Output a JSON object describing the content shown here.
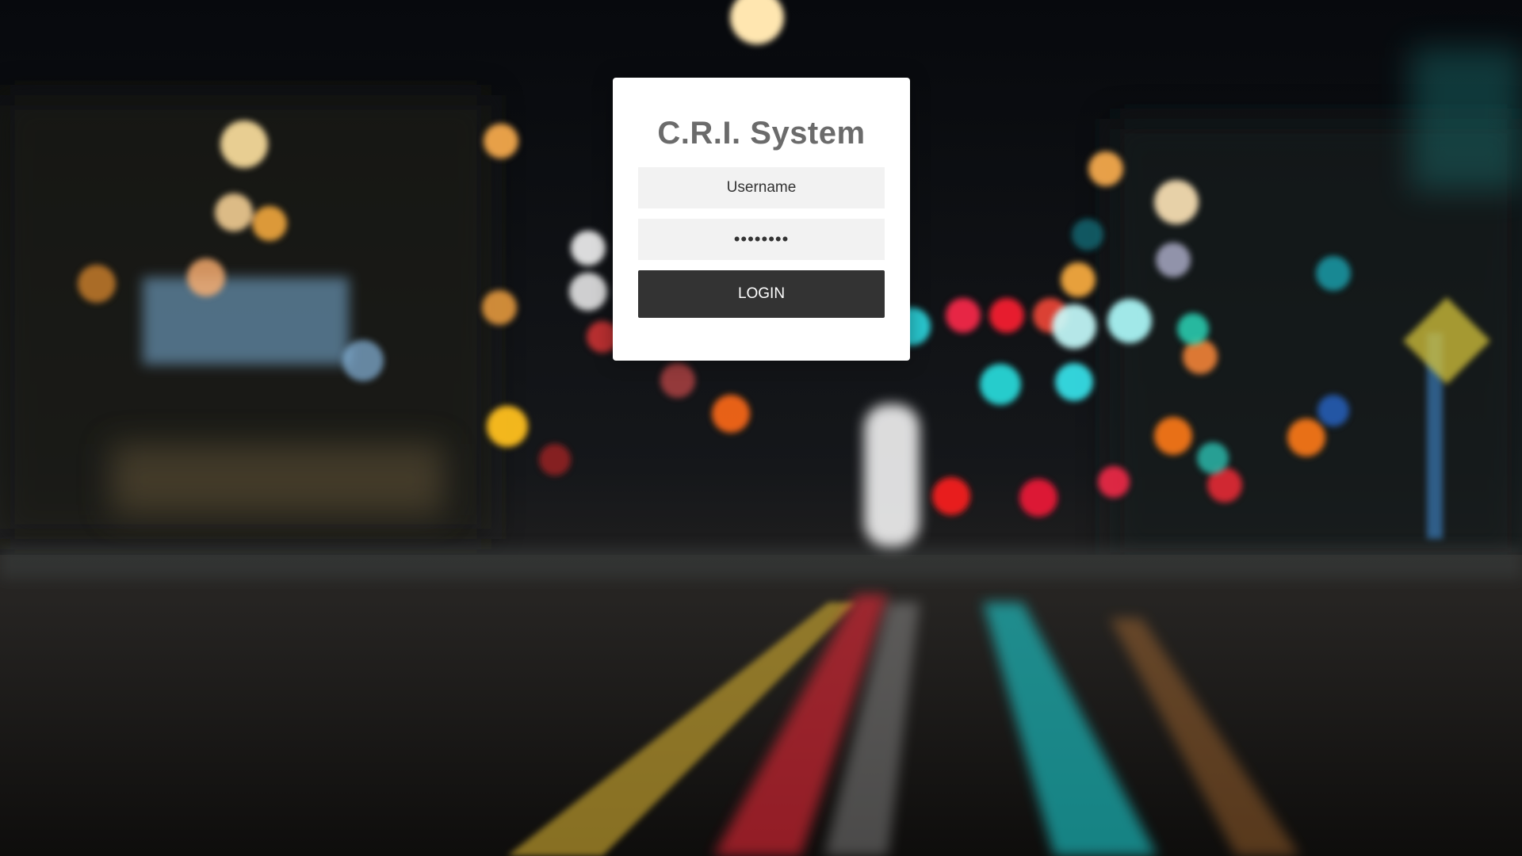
{
  "background": {
    "description_icon": "night-street-bokeh-image",
    "colors": {
      "sky": "#0b0d12",
      "road": "#1a1816",
      "red": "#ff2a3a",
      "cyan": "#1fe3e6",
      "amber": "#ffb347",
      "yellow_line": "#e0c040"
    }
  },
  "login": {
    "title": "C.R.I. System",
    "username_placeholder": "Username",
    "password_value": "••••••••",
    "button_label": "LOGIN"
  }
}
